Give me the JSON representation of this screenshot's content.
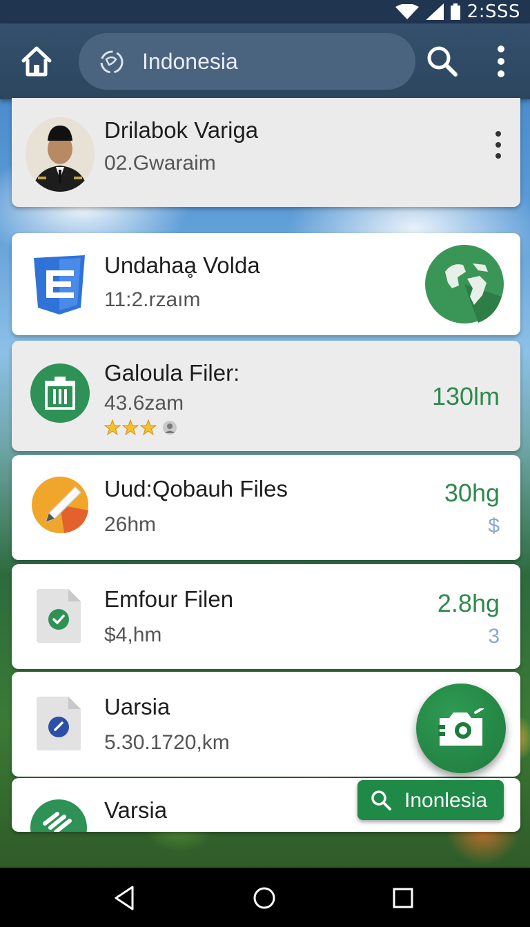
{
  "status_bar": {
    "time": "2:SSS",
    "icons": [
      "wifi-icon",
      "signal-icon",
      "battery-icon"
    ]
  },
  "app_bar": {
    "home_icon": "home-icon",
    "search_placeholder": "Indonesia",
    "search_icon": "search-icon",
    "more_icon": "more-vertical-icon"
  },
  "profile": {
    "name": "Drilabok Variga",
    "subtitle": "02.Gwaraim",
    "more_icon": "more-vertical-icon"
  },
  "items": [
    {
      "title": "Undahaḁ Volda",
      "subtitle": "11:2.rzaım",
      "icon": "document-icon",
      "badge_icon": "globe-icon"
    },
    {
      "title": "Galoula Filer:",
      "subtitle": "43.6zam",
      "value": "130lm",
      "icon": "trash-icon",
      "rating": 3
    },
    {
      "title": "Uud:Qobauh Files",
      "subtitle": "26hm",
      "value": "30hg",
      "badge": "$",
      "icon": "pencil-icon"
    },
    {
      "title": "Emfour Filen",
      "subtitle": "$4,hm",
      "value": "2.8hg",
      "badge": "3",
      "icon": "file-check-icon"
    },
    {
      "title": "Uarsia",
      "subtitle": "5.30.1720,km",
      "icon": "file-icon"
    },
    {
      "title": "Varsia",
      "icon": "app-icon"
    }
  ],
  "fab": {
    "icon": "camera-icon"
  },
  "search_chip": {
    "label": "Inonlesia",
    "icon": "search-icon"
  },
  "colors": {
    "app_bar": "#2c465f",
    "accent_green": "#2c8a4c",
    "badge_blue": "#8ba6d2"
  }
}
